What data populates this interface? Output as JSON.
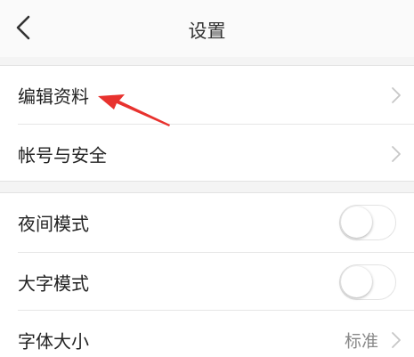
{
  "header": {
    "title": "设置",
    "back_icon": "chevron-left-icon"
  },
  "group1": {
    "items": [
      {
        "label": "编辑资料",
        "icon": "chevron-right-icon"
      },
      {
        "label": "帐号与安全",
        "icon": "chevron-right-icon"
      }
    ]
  },
  "group2": {
    "night_mode": {
      "label": "夜间模式",
      "enabled": false
    },
    "large_text": {
      "label": "大字模式",
      "enabled": false
    },
    "font_size": {
      "label": "字体大小",
      "value": "标准",
      "icon": "chevron-right-icon"
    }
  },
  "annotation": {
    "icon": "red-arrow-icon",
    "color": "#e8322e"
  },
  "colors": {
    "background": "#f4f4f4",
    "row_background": "#ffffff",
    "divider": "#e6e6e6",
    "muted_text": "#888888"
  }
}
